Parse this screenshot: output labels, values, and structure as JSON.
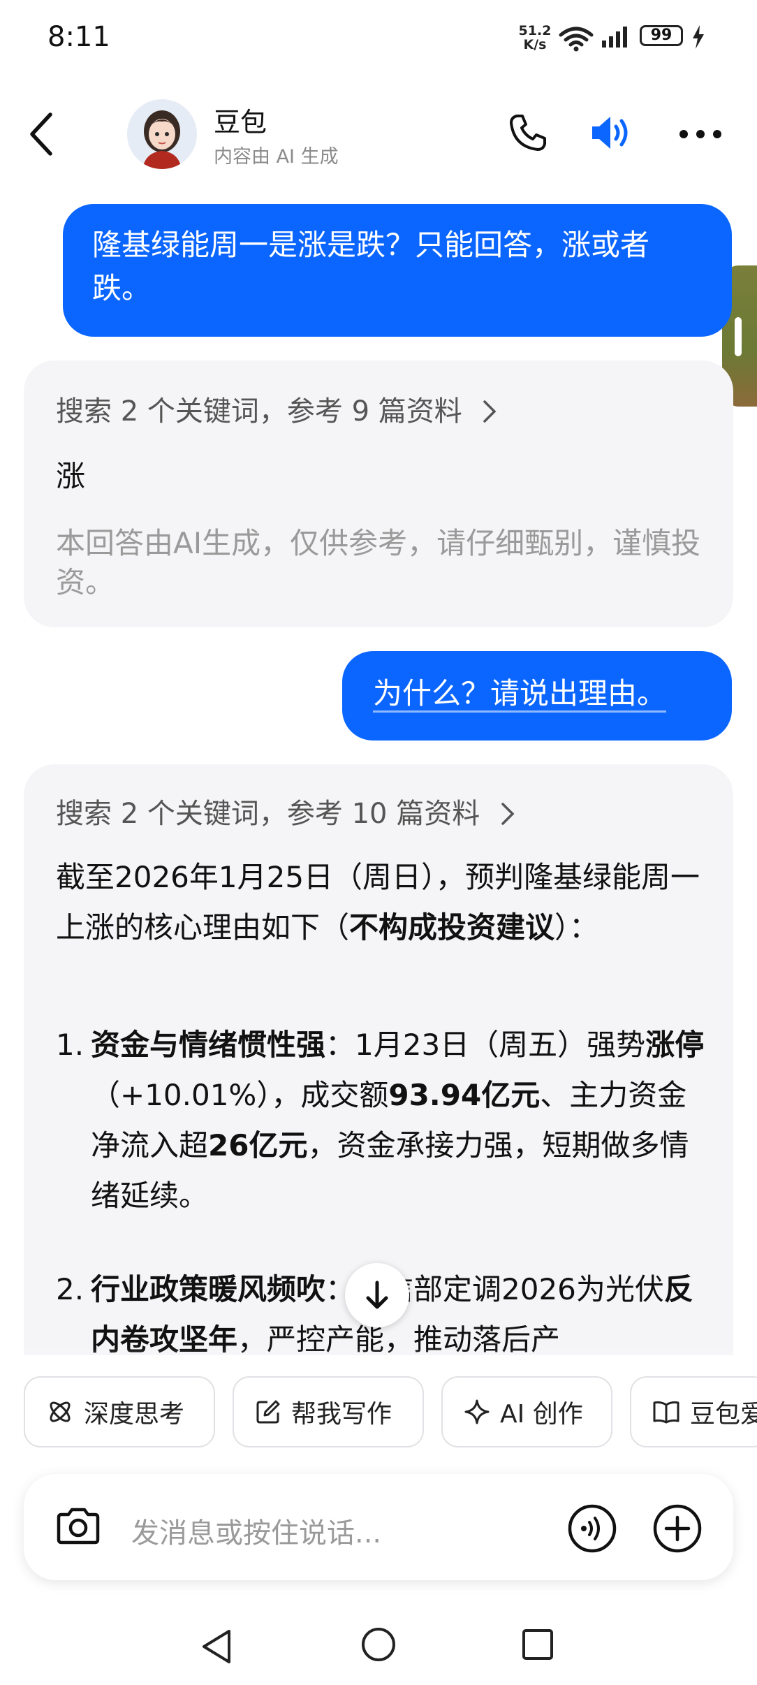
{
  "status_bar": {
    "time": "8:11",
    "net_speed_value": "51.2",
    "net_speed_unit": "K/s",
    "battery": "99"
  },
  "header": {
    "title": "豆包",
    "subtitle": "内容由 AI 生成",
    "icons": [
      "back-icon",
      "phone-icon",
      "speaker-icon",
      "more-icon"
    ]
  },
  "messages": {
    "user1": "隆基绿能周一是涨是跌？只能回答，涨或者跌。",
    "ai1": {
      "search": "搜索 2 个关键词，参考 9 篇资料",
      "answer": "涨",
      "disclaimer": "本回答由AI生成，仅供参考，请仔细甄别，谨慎投资。"
    },
    "user2": "为什么？请说出理由。",
    "ai2": {
      "search": "搜索 2 个关键词，参考 10 篇资料",
      "intro_a": "截至2026年1月25日（周日），预判隆基绿能周一上涨的核心理由如下（",
      "intro_bold": "不构成投资建议",
      "intro_b": "）：",
      "item1_num": "1.",
      "item1_bold1": "资金与情绪惯性强",
      "item1_t1": "：1月23日（周五）强势",
      "item1_bold2": "涨停",
      "item1_t2": "（+10.01%），成交额",
      "item1_bold3": "93.94亿元",
      "item1_t3": "、主力资金净流入超",
      "item1_bold4": "26亿元",
      "item1_t4": "，资金承接力强，短期做多情绪延续。",
      "item2_num": "2.",
      "item2_bold1": "行业政策暖风频吹",
      "item2_t1": "：工信部定调2026为光伏",
      "item2_bold2": "反内卷攻坚年",
      "item2_t2": "，严控产能，推动落后产"
    }
  },
  "quick_actions": [
    "深度思考",
    "帮我写作",
    "AI 创作",
    "豆包爱学"
  ],
  "input": {
    "placeholder": "发消息或按住说话..."
  },
  "colors": {
    "accent": "#0b66ff",
    "ai_bubble": "#f5f5f7",
    "muted_text": "#9a9a9a"
  }
}
